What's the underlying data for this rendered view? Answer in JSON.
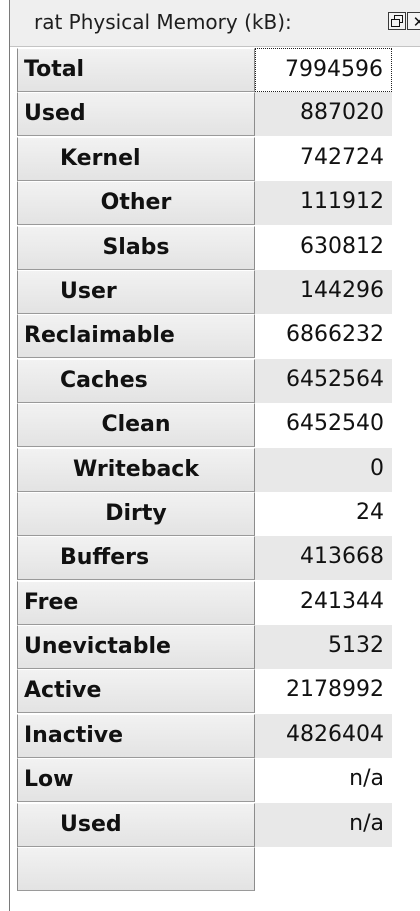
{
  "window": {
    "title": "rat Physical Memory (kB):",
    "restore_icon": "restore-icon",
    "close_icon": "close-icon",
    "close_glyph": "✕"
  },
  "rows": [
    {
      "label": "Total",
      "value": "7994596",
      "level": 0,
      "shaded": false,
      "focused": true
    },
    {
      "label": "Used",
      "value": "887020",
      "level": 0,
      "shaded": true,
      "focused": false
    },
    {
      "label": "Kernel",
      "value": "742724",
      "level": 1,
      "shaded": false,
      "focused": false
    },
    {
      "label": "Other",
      "value": "111912",
      "level": 2,
      "shaded": true,
      "focused": false
    },
    {
      "label": "Slabs",
      "value": "630812",
      "level": 2,
      "shaded": false,
      "focused": false
    },
    {
      "label": "User",
      "value": "144296",
      "level": 1,
      "shaded": true,
      "focused": false
    },
    {
      "label": "Reclaimable",
      "value": "6866232",
      "level": 0,
      "shaded": false,
      "focused": false
    },
    {
      "label": "Caches",
      "value": "6452564",
      "level": 1,
      "shaded": true,
      "focused": false
    },
    {
      "label": "Clean",
      "value": "6452540",
      "level": 2,
      "shaded": false,
      "focused": false
    },
    {
      "label": "Writeback",
      "value": "0",
      "level": 2,
      "shaded": true,
      "focused": false
    },
    {
      "label": "Dirty",
      "value": "24",
      "level": 2,
      "shaded": false,
      "focused": false
    },
    {
      "label": "Buffers",
      "value": "413668",
      "level": 1,
      "shaded": true,
      "focused": false
    },
    {
      "label": "Free",
      "value": "241344",
      "level": 0,
      "shaded": false,
      "focused": false
    },
    {
      "label": "Unevictable",
      "value": "5132",
      "level": 0,
      "shaded": true,
      "focused": false
    },
    {
      "label": "Active",
      "value": "2178992",
      "level": 0,
      "shaded": false,
      "focused": false
    },
    {
      "label": "Inactive",
      "value": "4826404",
      "level": 0,
      "shaded": true,
      "focused": false
    },
    {
      "label": "Low",
      "value": "n/a",
      "level": 0,
      "shaded": false,
      "focused": false
    },
    {
      "label": "Used",
      "value": "n/a",
      "level": 1,
      "shaded": true,
      "focused": false
    },
    {
      "label": "",
      "value": "",
      "level": 0,
      "shaded": false,
      "focused": false
    }
  ]
}
